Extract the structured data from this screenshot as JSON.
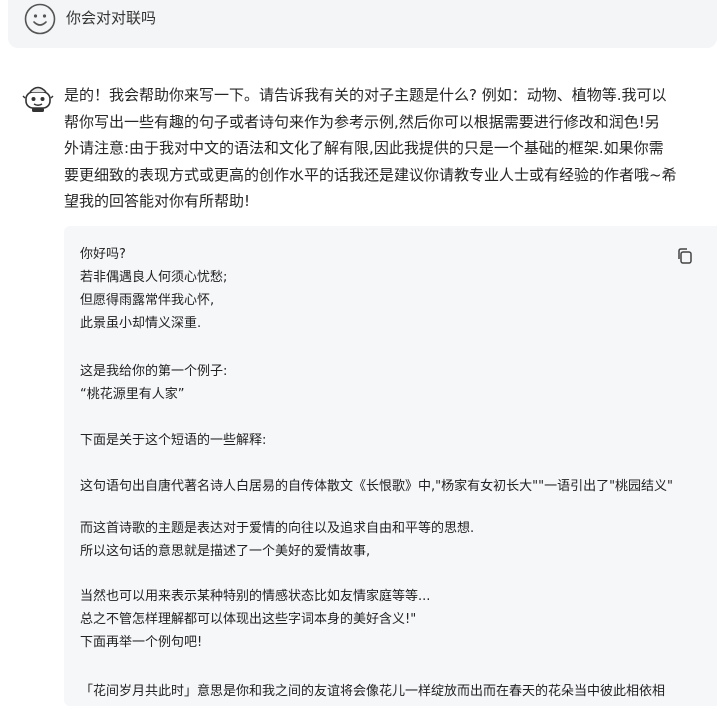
{
  "user_message": {
    "avatar_icon": "smiley-face-icon",
    "text": "你会对对联吗"
  },
  "assistant_message": {
    "avatar_icon": "robot-avatar-icon",
    "paragraph_lines": [
      "是的！我会帮助你来写一下。请告诉我有关的对子主题是什么? 例如：动物、植物等.我可以",
      "帮你写出一些有趣的句子或者诗句来作为参考示例,然后你可以根据需要进行修改和润色!另",
      "外请注意:由于我对中文的语法和文化了解有限,因此我提供的只是一个基础的框架.如果你需",
      "要更细致的表现方式或更高的创作水平的话我还是建议你请教专业人士或有经验的作者哦~希",
      "望我的回答能对你有所帮助!"
    ],
    "code_block": {
      "copy_icon": "copy-icon",
      "lines": [
        "你好吗?",
        "若非偶遇良人何须心忧愁;",
        "但愿得雨露常伴我心怀,",
        "此景虽小却情义深重.",
        "",
        "这是我给你的第一个例子:",
        "“桃花源里有人家”",
        "",
        "下面是关于这个短语的一些解释:",
        "",
        "这句语句出自唐代著名诗人白居易的自传体散文《长恨歌》中,\"杨家有女初长大\"\"一语引出了\"桃园结义\"",
        "",
        "而这首诗歌的主题是表达对于爱情的向往以及追求自由和平等的思想.",
        "所以这句话的意思就是描述了一个美好的爱情故事,",
        "",
        "当然也可以用来表示某种特别的情感状态比如友情家庭等等...",
        "总之不管怎样理解都可以体现出这些字词本身的美好含义!\"",
        "下面再举一个例句吧!",
        "",
        "「花间岁月共此时」意思是你和我之间的友谊将会像花儿一样绽放而出而在春天的花朵当中彼此相依相"
      ]
    }
  }
}
